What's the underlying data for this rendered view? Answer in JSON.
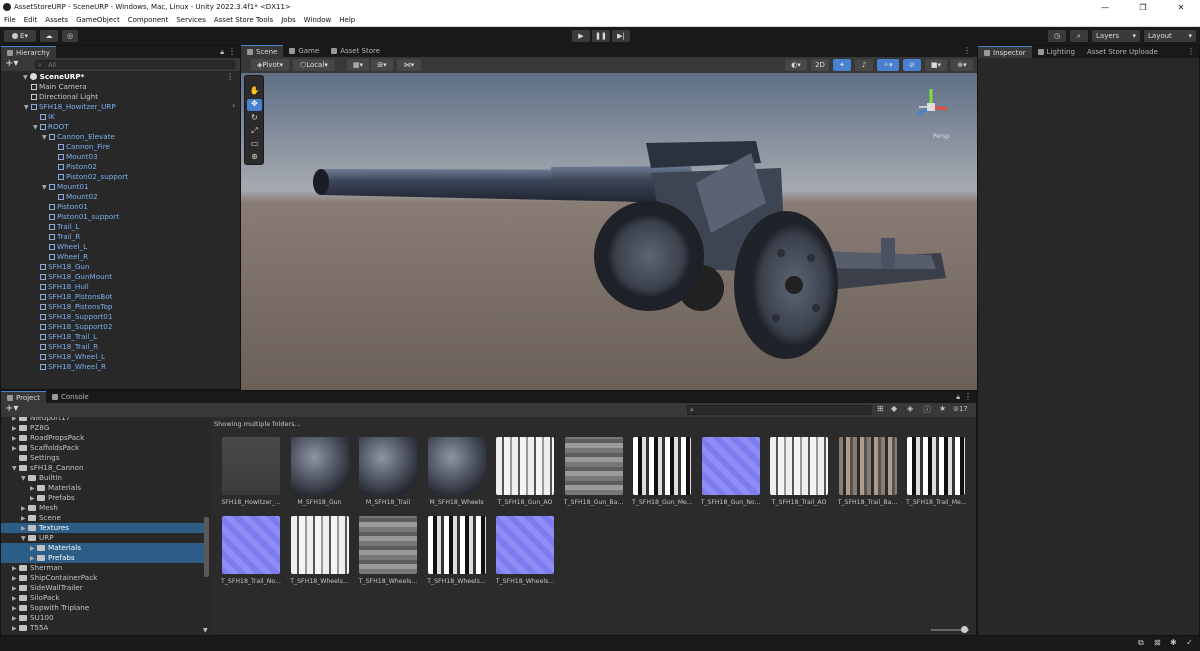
{
  "window": {
    "title": "AssetStoreURP - SceneURP - Windows, Mac, Linux - Unity 2022.3.4f1* <DX11>",
    "min": "—",
    "max": "❐",
    "close": "✕"
  },
  "menu": [
    "File",
    "Edit",
    "Assets",
    "GameObject",
    "Component",
    "Services",
    "Asset Store Tools",
    "Jobs",
    "Window",
    "Help"
  ],
  "toolbar": {
    "account": "E",
    "layers": "Layers",
    "layout": "Layout"
  },
  "hierarchy": {
    "tab": "Hierarchy",
    "search_placeholder": "All",
    "scene": "SceneURP*",
    "items": [
      {
        "label": "Main Camera",
        "indent": 1,
        "blue": false
      },
      {
        "label": "Directional Light",
        "indent": 1,
        "blue": false
      },
      {
        "label": "SFH18_Howitzer_URP",
        "indent": 1,
        "blue": true,
        "arrow": true
      },
      {
        "label": "IK",
        "indent": 2,
        "blue": true
      },
      {
        "label": "ROOT",
        "indent": 2,
        "blue": true,
        "arrow": true
      },
      {
        "label": "Cannon_Elevate",
        "indent": 3,
        "blue": true,
        "arrow": true
      },
      {
        "label": "Cannon_Fire",
        "indent": 4,
        "blue": true
      },
      {
        "label": "Mount03",
        "indent": 4,
        "blue": true
      },
      {
        "label": "Piston02",
        "indent": 4,
        "blue": true
      },
      {
        "label": "Piston02_support",
        "indent": 4,
        "blue": true
      },
      {
        "label": "Mount01",
        "indent": 3,
        "blue": true,
        "arrow": true
      },
      {
        "label": "Mount02",
        "indent": 4,
        "blue": true
      },
      {
        "label": "Piston01",
        "indent": 3,
        "blue": true
      },
      {
        "label": "Piston01_support",
        "indent": 3,
        "blue": true
      },
      {
        "label": "Trail_L",
        "indent": 3,
        "blue": true
      },
      {
        "label": "Trail_R",
        "indent": 3,
        "blue": true
      },
      {
        "label": "Wheel_L",
        "indent": 3,
        "blue": true
      },
      {
        "label": "Wheel_R",
        "indent": 3,
        "blue": true
      },
      {
        "label": "SFH18_Gun",
        "indent": 2,
        "blue": true
      },
      {
        "label": "SFH18_GunMount",
        "indent": 2,
        "blue": true
      },
      {
        "label": "SFH18_Hull",
        "indent": 2,
        "blue": true
      },
      {
        "label": "SFH18_PistonsBot",
        "indent": 2,
        "blue": true
      },
      {
        "label": "SFH18_PistonsTop",
        "indent": 2,
        "blue": true
      },
      {
        "label": "SFH18_Support01",
        "indent": 2,
        "blue": true
      },
      {
        "label": "SFH18_Support02",
        "indent": 2,
        "blue": true
      },
      {
        "label": "SFH18_Trail_L",
        "indent": 2,
        "blue": true
      },
      {
        "label": "SFH18_Trail_R",
        "indent": 2,
        "blue": true
      },
      {
        "label": "SFH18_Wheel_L",
        "indent": 2,
        "blue": true
      },
      {
        "label": "SFH18_Wheel_R",
        "indent": 2,
        "blue": true
      }
    ]
  },
  "scene": {
    "tabs": [
      "Scene",
      "Game",
      "Asset Store"
    ],
    "pivot": "Pivot",
    "local": "Local",
    "mode2d": "2D",
    "gizmo_label": "Persp"
  },
  "inspector": {
    "tabs": [
      "Inspector",
      "Lighting",
      "Asset Store Uploade"
    ]
  },
  "project": {
    "tabs": [
      "Project",
      "Console"
    ],
    "showing": "Showing multiple folders...",
    "count": "17",
    "folders": [
      {
        "label": "Nieuport17",
        "indent": 1
      },
      {
        "label": "PZ8G",
        "indent": 1
      },
      {
        "label": "RoadPropsPack",
        "indent": 1
      },
      {
        "label": "ScaffoldsPack",
        "indent": 1
      },
      {
        "label": "Settings",
        "indent": 1,
        "noarrow": true
      },
      {
        "label": "sFH18_Cannon",
        "indent": 1,
        "open": true
      },
      {
        "label": "BuiltIn",
        "indent": 2,
        "open": true
      },
      {
        "label": "Materials",
        "indent": 3
      },
      {
        "label": "Prefabs",
        "indent": 3
      },
      {
        "label": "Mesh",
        "indent": 2
      },
      {
        "label": "Scene",
        "indent": 2
      },
      {
        "label": "Textures",
        "indent": 2,
        "sel": true
      },
      {
        "label": "URP",
        "indent": 2,
        "open": true
      },
      {
        "label": "Materials",
        "indent": 3,
        "sel": true
      },
      {
        "label": "Prefabs",
        "indent": 3,
        "sel": true
      },
      {
        "label": "Sherman",
        "indent": 1
      },
      {
        "label": "ShipContainerPack",
        "indent": 1
      },
      {
        "label": "SideWallTrailer",
        "indent": 1
      },
      {
        "label": "SiloPack",
        "indent": 1
      },
      {
        "label": "Sopwith Triplane",
        "indent": 1
      },
      {
        "label": "SU100",
        "indent": 1
      },
      {
        "label": "T55A",
        "indent": 1
      }
    ],
    "assets": [
      {
        "label": "SFH18_Howitzer_...",
        "kind": "prefab"
      },
      {
        "label": "M_SFH18_Gun",
        "kind": "sphere"
      },
      {
        "label": "M_SFH18_Trail",
        "kind": "sphere"
      },
      {
        "label": "M_SFH18_Wheels",
        "kind": "sphere"
      },
      {
        "label": "T_SFH18_Gun_AO",
        "kind": "tex_white"
      },
      {
        "label": "T_SFH18_Gun_Ba...",
        "kind": "tex_gray"
      },
      {
        "label": "T_SFH18_Gun_Me...",
        "kind": "tex_bw"
      },
      {
        "label": "T_SFH18_Gun_No...",
        "kind": "normal"
      },
      {
        "label": "T_SFH18_Trail_AO",
        "kind": "tex_white"
      },
      {
        "label": "T_SFH18_Trail_Ba...",
        "kind": "tex_rust"
      },
      {
        "label": "T_SFH18_Trail_Me...",
        "kind": "tex_bw"
      },
      {
        "label": "T_SFH18_Trail_No...",
        "kind": "normal"
      },
      {
        "label": "T_SFH18_Wheels...",
        "kind": "tex_white"
      },
      {
        "label": "T_SFH18_Wheels...",
        "kind": "tex_gray"
      },
      {
        "label": "T_SFH18_Wheels...",
        "kind": "tex_bw"
      },
      {
        "label": "T_SFH18_Wheels...",
        "kind": "normal"
      }
    ]
  },
  "colors": {
    "accent": "#4a80d0",
    "selection": "#2c5d87",
    "link": "#7bb0f0"
  }
}
